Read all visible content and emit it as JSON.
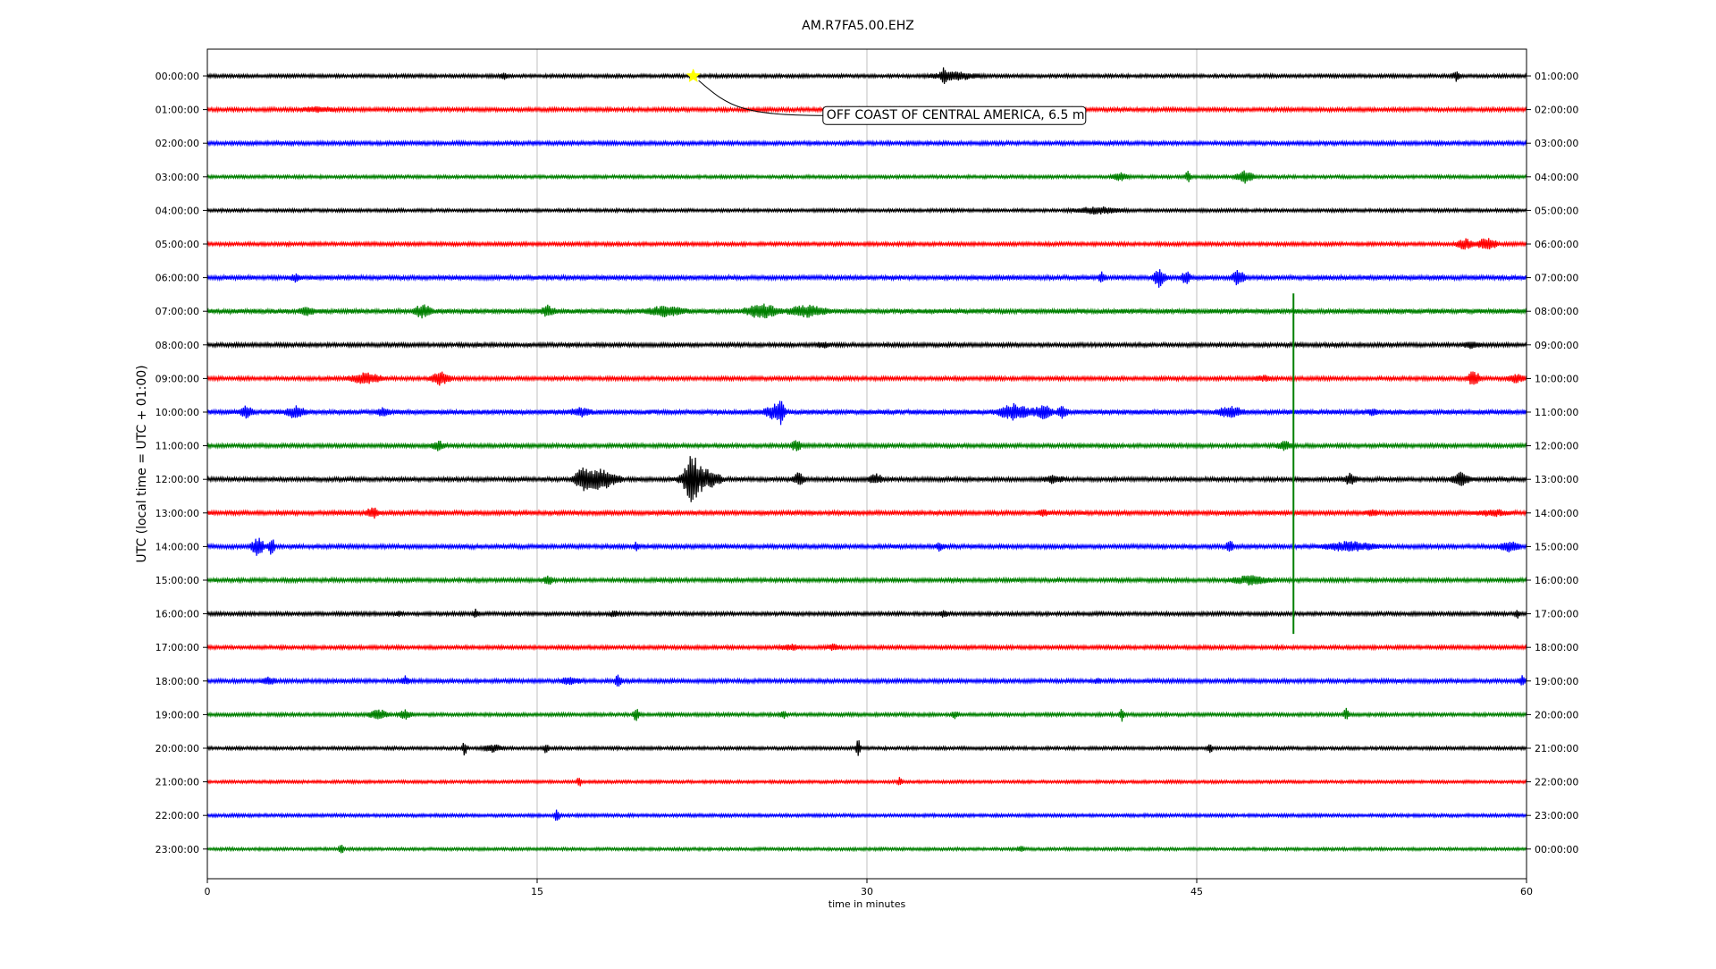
{
  "chart_data": {
    "type": "line",
    "title": "AM.R7FA5.00.EHZ",
    "xlabel": "time in minutes",
    "ylabel": "UTC (local time = UTC + 01:00)",
    "xlim": [
      0,
      60
    ],
    "x_ticks": [
      0,
      15,
      30,
      45,
      60
    ],
    "x_tick_labels": [
      "0",
      "15",
      "30",
      "45",
      "60"
    ],
    "grid": "vertical lines at x ticks",
    "colors": [
      "#000000",
      "#ff0000",
      "#0000ff",
      "#008000"
    ],
    "rows_left": [
      "00:00:00",
      "01:00:00",
      "02:00:00",
      "03:00:00",
      "04:00:00",
      "05:00:00",
      "06:00:00",
      "07:00:00",
      "08:00:00",
      "09:00:00",
      "10:00:00",
      "11:00:00",
      "12:00:00",
      "13:00:00",
      "14:00:00",
      "15:00:00",
      "16:00:00",
      "17:00:00",
      "18:00:00",
      "19:00:00",
      "20:00:00",
      "21:00:00",
      "22:00:00",
      "23:00:00"
    ],
    "rows_right": [
      "01:00:00",
      "02:00:00",
      "03:00:00",
      "04:00:00",
      "05:00:00",
      "06:00:00",
      "07:00:00",
      "08:00:00",
      "09:00:00",
      "10:00:00",
      "11:00:00",
      "12:00:00",
      "13:00:00",
      "14:00:00",
      "15:00:00",
      "16:00:00",
      "17:00:00",
      "18:00:00",
      "19:00:00",
      "20:00:00",
      "21:00:00",
      "22:00:00",
      "23:00:00",
      "00:00:00"
    ],
    "base_noise": [
      1.4,
      1.6,
      1.6,
      1.3,
      1.3,
      1.5,
      1.8,
      2.0,
      1.6,
      1.6,
      2.0,
      1.6,
      1.7,
      1.7,
      1.7,
      1.6,
      1.5,
      1.5,
      1.6,
      1.4,
      1.3,
      1.2,
      1.3,
      1.2
    ],
    "bursts": [
      {
        "row": 0,
        "minute": 13.5,
        "amp": 3,
        "dur": 0.3
      },
      {
        "row": 0,
        "minute": 33.5,
        "amp": 9,
        "dur": 0.2
      },
      {
        "row": 0,
        "minute": 34.0,
        "amp": 4,
        "dur": 1.5
      },
      {
        "row": 0,
        "minute": 56.8,
        "amp": 5,
        "dur": 0.3
      },
      {
        "row": 1,
        "minute": 5.0,
        "amp": 2.5,
        "dur": 1.0
      },
      {
        "row": 3,
        "minute": 41.5,
        "amp": 4,
        "dur": 0.5
      },
      {
        "row": 3,
        "minute": 44.6,
        "amp": 6,
        "dur": 0.2
      },
      {
        "row": 3,
        "minute": 47.2,
        "amp": 7,
        "dur": 0.6
      },
      {
        "row": 4,
        "minute": 40.5,
        "amp": 3.5,
        "dur": 1.5
      },
      {
        "row": 5,
        "minute": 57.2,
        "amp": 6,
        "dur": 0.5
      },
      {
        "row": 5,
        "minute": 58.2,
        "amp": 7,
        "dur": 0.6
      },
      {
        "row": 6,
        "minute": 4.0,
        "amp": 4,
        "dur": 0.3
      },
      {
        "row": 6,
        "minute": 40.7,
        "amp": 7,
        "dur": 0.2
      },
      {
        "row": 6,
        "minute": 43.3,
        "amp": 10,
        "dur": 0.4
      },
      {
        "row": 6,
        "minute": 44.5,
        "amp": 7,
        "dur": 0.3
      },
      {
        "row": 6,
        "minute": 46.9,
        "amp": 9,
        "dur": 0.4
      },
      {
        "row": 7,
        "minute": 4.5,
        "amp": 4,
        "dur": 0.5
      },
      {
        "row": 7,
        "minute": 9.8,
        "amp": 8,
        "dur": 0.5
      },
      {
        "row": 7,
        "minute": 15.5,
        "amp": 6,
        "dur": 0.4
      },
      {
        "row": 7,
        "minute": 20.8,
        "amp": 5,
        "dur": 1.2
      },
      {
        "row": 7,
        "minute": 25.2,
        "amp": 8,
        "dur": 1.0
      },
      {
        "row": 7,
        "minute": 27.3,
        "amp": 6,
        "dur": 1.2
      },
      {
        "row": 7,
        "minute": 49.4,
        "amp": 1.0,
        "dur": 0.05,
        "spike": true
      },
      {
        "row": 8,
        "minute": 28.0,
        "amp": 3,
        "dur": 0.4
      },
      {
        "row": 8,
        "minute": 57.5,
        "amp": 3,
        "dur": 0.6
      },
      {
        "row": 9,
        "minute": 7.2,
        "amp": 6,
        "dur": 1.0
      },
      {
        "row": 9,
        "minute": 10.6,
        "amp": 8,
        "dur": 0.6
      },
      {
        "row": 9,
        "minute": 48.0,
        "amp": 3,
        "dur": 0.5
      },
      {
        "row": 9,
        "minute": 57.6,
        "amp": 9,
        "dur": 0.4
      },
      {
        "row": 9,
        "minute": 59.5,
        "amp": 5,
        "dur": 0.5
      },
      {
        "row": 10,
        "minute": 1.8,
        "amp": 7,
        "dur": 0.4
      },
      {
        "row": 10,
        "minute": 4.0,
        "amp": 6,
        "dur": 0.6
      },
      {
        "row": 10,
        "minute": 8.0,
        "amp": 4,
        "dur": 0.4
      },
      {
        "row": 10,
        "minute": 17.0,
        "amp": 4,
        "dur": 0.6
      },
      {
        "row": 10,
        "minute": 25.8,
        "amp": 8,
        "dur": 0.6
      },
      {
        "row": 10,
        "minute": 26.1,
        "amp": 12,
        "dur": 0.2
      },
      {
        "row": 10,
        "minute": 36.7,
        "amp": 9,
        "dur": 1.0
      },
      {
        "row": 10,
        "minute": 38.0,
        "amp": 9,
        "dur": 0.6
      },
      {
        "row": 10,
        "minute": 38.9,
        "amp": 8,
        "dur": 0.3
      },
      {
        "row": 10,
        "minute": 46.5,
        "amp": 6,
        "dur": 0.8
      },
      {
        "row": 10,
        "minute": 53.0,
        "amp": 3,
        "dur": 0.3
      },
      {
        "row": 11,
        "minute": 10.5,
        "amp": 5,
        "dur": 0.4
      },
      {
        "row": 11,
        "minute": 26.8,
        "amp": 7,
        "dur": 0.3
      },
      {
        "row": 11,
        "minute": 49.0,
        "amp": 5,
        "dur": 0.5
      },
      {
        "row": 12,
        "minute": 17.0,
        "amp": 10,
        "dur": 0.5
      },
      {
        "row": 12,
        "minute": 17.8,
        "amp": 12,
        "dur": 1.2
      },
      {
        "row": 12,
        "minute": 22.0,
        "amp": 24,
        "dur": 0.4
      },
      {
        "row": 12,
        "minute": 22.4,
        "amp": 14,
        "dur": 1.2
      },
      {
        "row": 12,
        "minute": 26.9,
        "amp": 7,
        "dur": 0.4
      },
      {
        "row": 12,
        "minute": 30.4,
        "amp": 6,
        "dur": 0.4
      },
      {
        "row": 12,
        "minute": 38.5,
        "amp": 4,
        "dur": 0.6
      },
      {
        "row": 12,
        "minute": 52.0,
        "amp": 6,
        "dur": 0.4
      },
      {
        "row": 12,
        "minute": 57.0,
        "amp": 7,
        "dur": 0.6
      },
      {
        "row": 13,
        "minute": 7.5,
        "amp": 6,
        "dur": 0.4
      },
      {
        "row": 13,
        "minute": 38.0,
        "amp": 3,
        "dur": 0.4
      },
      {
        "row": 13,
        "minute": 53.0,
        "amp": 3,
        "dur": 0.4
      },
      {
        "row": 13,
        "minute": 58.5,
        "amp": 3,
        "dur": 1.0
      },
      {
        "row": 14,
        "minute": 2.3,
        "amp": 10,
        "dur": 0.4
      },
      {
        "row": 14,
        "minute": 2.9,
        "amp": 12,
        "dur": 0.2
      },
      {
        "row": 14,
        "minute": 19.5,
        "amp": 4,
        "dur": 0.2
      },
      {
        "row": 14,
        "minute": 33.3,
        "amp": 4,
        "dur": 0.3
      },
      {
        "row": 14,
        "minute": 46.5,
        "amp": 9,
        "dur": 0.2
      },
      {
        "row": 14,
        "minute": 52.0,
        "amp": 5,
        "dur": 1.6
      },
      {
        "row": 14,
        "minute": 59.2,
        "amp": 6,
        "dur": 0.6
      },
      {
        "row": 15,
        "minute": 15.5,
        "amp": 4,
        "dur": 0.4
      },
      {
        "row": 15,
        "minute": 47.5,
        "amp": 5,
        "dur": 1.2
      },
      {
        "row": 16,
        "minute": 8.7,
        "amp": 3,
        "dur": 0.2
      },
      {
        "row": 16,
        "minute": 12.2,
        "amp": 4,
        "dur": 0.2
      },
      {
        "row": 16,
        "minute": 18.5,
        "amp": 3,
        "dur": 0.3
      },
      {
        "row": 16,
        "minute": 33.5,
        "amp": 3,
        "dur": 0.3
      },
      {
        "row": 16,
        "minute": 59.6,
        "amp": 4,
        "dur": 0.2
      },
      {
        "row": 17,
        "minute": 26.5,
        "amp": 3,
        "dur": 0.6
      },
      {
        "row": 17,
        "minute": 28.5,
        "amp": 3,
        "dur": 0.4
      },
      {
        "row": 18,
        "minute": 2.8,
        "amp": 4,
        "dur": 0.4
      },
      {
        "row": 18,
        "minute": 9.0,
        "amp": 5,
        "dur": 0.3
      },
      {
        "row": 18,
        "minute": 16.5,
        "amp": 4,
        "dur": 0.6
      },
      {
        "row": 18,
        "minute": 18.7,
        "amp": 8,
        "dur": 0.2
      },
      {
        "row": 18,
        "minute": 40.5,
        "amp": 3,
        "dur": 0.2
      },
      {
        "row": 18,
        "minute": 59.8,
        "amp": 5,
        "dur": 0.2
      },
      {
        "row": 19,
        "minute": 7.8,
        "amp": 6,
        "dur": 0.6
      },
      {
        "row": 19,
        "minute": 9.0,
        "amp": 5,
        "dur": 0.4
      },
      {
        "row": 19,
        "minute": 19.5,
        "amp": 8,
        "dur": 0.2
      },
      {
        "row": 19,
        "minute": 26.2,
        "amp": 4,
        "dur": 0.2
      },
      {
        "row": 19,
        "minute": 34.0,
        "amp": 4,
        "dur": 0.2
      },
      {
        "row": 19,
        "minute": 41.6,
        "amp": 8,
        "dur": 0.15
      },
      {
        "row": 19,
        "minute": 51.8,
        "amp": 10,
        "dur": 0.15
      },
      {
        "row": 20,
        "minute": 11.7,
        "amp": 8,
        "dur": 0.15
      },
      {
        "row": 20,
        "minute": 13.0,
        "amp": 4,
        "dur": 0.6
      },
      {
        "row": 20,
        "minute": 15.4,
        "amp": 5,
        "dur": 0.2
      },
      {
        "row": 20,
        "minute": 29.6,
        "amp": 10,
        "dur": 0.15
      },
      {
        "row": 20,
        "minute": 45.6,
        "amp": 7,
        "dur": 0.15
      },
      {
        "row": 21,
        "minute": 16.9,
        "amp": 7,
        "dur": 0.15
      },
      {
        "row": 21,
        "minute": 31.5,
        "amp": 5,
        "dur": 0.15
      },
      {
        "row": 22,
        "minute": 15.9,
        "amp": 9,
        "dur": 0.15
      },
      {
        "row": 23,
        "minute": 6.1,
        "amp": 6,
        "dur": 0.15
      },
      {
        "row": 23,
        "minute": 37.0,
        "amp": 3,
        "dur": 0.2
      }
    ],
    "big_spike": {
      "row": 7,
      "minute": 49.4,
      "to_row": 16.6
    },
    "event": {
      "label": "OFF COAST OF CENTRAL AMERICA, 6.5 m",
      "row": 0,
      "minute": 22.1,
      "marker_color": "#ffff00",
      "label_row": 1.15,
      "label_minute": 28.0
    }
  }
}
